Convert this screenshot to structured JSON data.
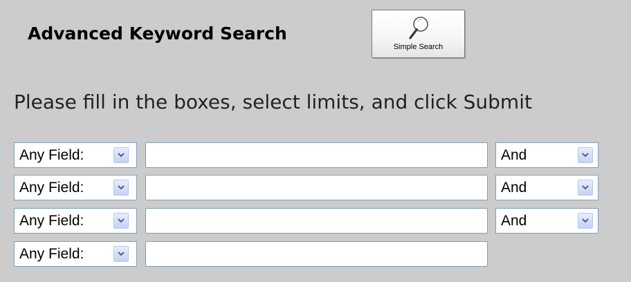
{
  "header": {
    "title": "Advanced Keyword Search",
    "simple_search_button": {
      "label": "Simple Search",
      "icon": "magnifier-icon"
    }
  },
  "instructions": "Please fill in the boxes, select limits, and click Submit",
  "rows": [
    {
      "field": "Any Field:",
      "keyword": "",
      "operator": "And"
    },
    {
      "field": "Any Field:",
      "keyword": "",
      "operator": "And"
    },
    {
      "field": "Any Field:",
      "keyword": "",
      "operator": "And"
    },
    {
      "field": "Any Field:",
      "keyword": ""
    }
  ],
  "colors": {
    "panel_background": "#cccccc",
    "input_border": "#7f9db9",
    "dropdown_button": "#c3d3f6"
  }
}
